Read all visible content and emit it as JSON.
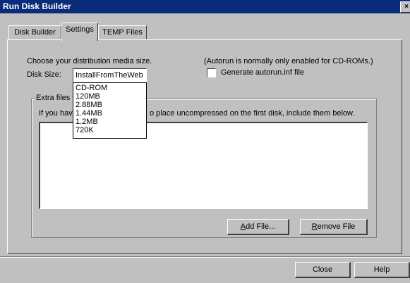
{
  "window": {
    "title": "Run Disk Builder",
    "close_glyph": "×"
  },
  "tabs": [
    {
      "label": "Disk Builder",
      "active": false
    },
    {
      "label": "Settings",
      "active": true
    },
    {
      "label": "TEMP Files",
      "active": false
    }
  ],
  "settings": {
    "media_prompt": "Choose your distribution media size.",
    "disk_size_label": "Disk Size:",
    "disk_size_value": "InstallFromTheWeb",
    "disk_size_options": [
      "CD-ROM",
      "120MB",
      "2.88MB",
      "1.44MB",
      "1.2MB",
      "720K"
    ],
    "autorun_note": "(Autorun is normally only enabled for CD-ROMs.)",
    "autorun_checkbox_label": "Generate autorun.inf file",
    "autorun_checked": false,
    "extra_files_group_label": "Extra files f",
    "extra_files_description_left": "If you hav",
    "extra_files_description_right": "o place uncompressed on the first disk, include them below.",
    "add_file_button": {
      "prefix": "",
      "accel": "A",
      "suffix": "dd File..."
    },
    "remove_file_button": {
      "prefix": "",
      "accel": "R",
      "suffix": "emove File"
    }
  },
  "footer": {
    "close_button": "Close",
    "help_button": "Help"
  },
  "colors": {
    "face": "#c0c0c0",
    "titlebar": "#0a2a7a",
    "shadow": "#404040"
  }
}
